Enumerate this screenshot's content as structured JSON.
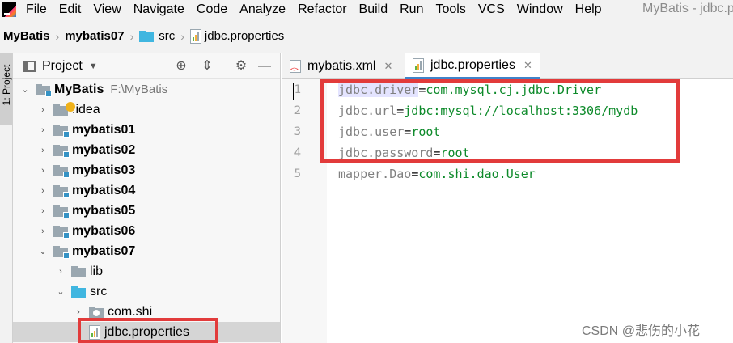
{
  "menubar": {
    "items": [
      "File",
      "Edit",
      "View",
      "Navigate",
      "Code",
      "Analyze",
      "Refactor",
      "Build",
      "Run",
      "Tools",
      "VCS",
      "Window",
      "Help"
    ],
    "window_title": "MyBatis - jdbc.p"
  },
  "breadcrumb": [
    "MyBatis",
    "mybatis07",
    "src",
    "jdbc.properties"
  ],
  "toolstrip": {
    "label": "1: Project"
  },
  "project_panel": {
    "title": "Project",
    "tree": [
      {
        "label": "MyBatis",
        "path": "F:\\MyBatis",
        "bold": true
      },
      {
        "label": ".idea"
      },
      {
        "label": "mybatis01",
        "bold": true
      },
      {
        "label": "mybatis02",
        "bold": true
      },
      {
        "label": "mybatis03",
        "bold": true
      },
      {
        "label": "mybatis04",
        "bold": true
      },
      {
        "label": "mybatis05",
        "bold": true
      },
      {
        "label": "mybatis06",
        "bold": true
      },
      {
        "label": "mybatis07",
        "bold": true
      },
      {
        "label": "lib"
      },
      {
        "label": "src"
      },
      {
        "label": "com.shi"
      },
      {
        "label": "jdbc.properties",
        "selected": true
      }
    ]
  },
  "editor": {
    "tabs": [
      {
        "label": "mybatis.xml",
        "active": false
      },
      {
        "label": "jdbc.properties",
        "active": true
      }
    ],
    "lines": [
      {
        "no": "1",
        "key": "jdbc.driver",
        "value": "com.mysql.cj.jdbc.Driver"
      },
      {
        "no": "2",
        "key": "jdbc.url",
        "value": "jdbc:mysql://localhost:3306/mydb"
      },
      {
        "no": "3",
        "key": "jdbc.user",
        "value": "root"
      },
      {
        "no": "4",
        "key": "jdbc.password",
        "value": "root"
      },
      {
        "no": "5",
        "key": "mapper.Dao",
        "value": "com.shi.dao.User"
      }
    ]
  },
  "watermark": "CSDN @悲伤的小花",
  "colors": {
    "annotation": "#e23b3b",
    "value_green": "#0d8a2a",
    "key_gray": "#808080",
    "tab_accent": "#4083c9"
  }
}
